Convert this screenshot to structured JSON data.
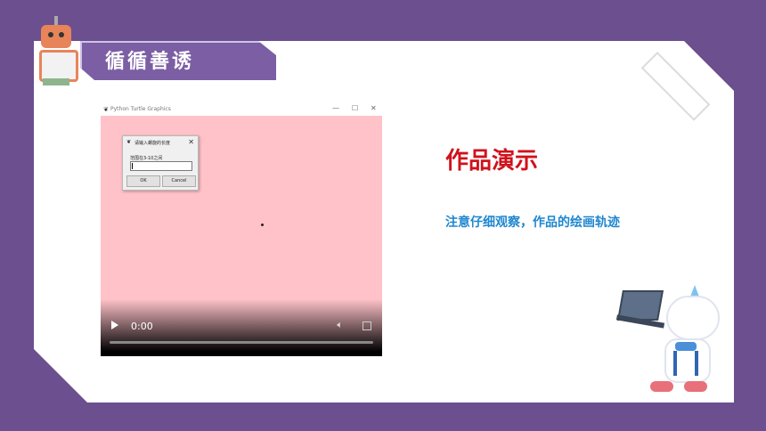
{
  "banner": {
    "title": "循循善诱"
  },
  "video_window": {
    "app_title": "Python Turtle Graphics",
    "minimize": "—",
    "maximize": "☐",
    "close": "✕",
    "dialog": {
      "title": "请输入螺旋的长度",
      "prompt": "范围在3-10之间",
      "input_value": "",
      "ok_label": "OK",
      "cancel_label": "Cancel",
      "close": "✕"
    },
    "player": {
      "time": "0:00",
      "progress": 0
    }
  },
  "main": {
    "heading": "作品演示",
    "subtitle": "注意仔细观察，作品的绘画轨迹"
  },
  "colors": {
    "background": "#6b4f8f",
    "heading": "#d0121b",
    "subtitle": "#1f86cf",
    "canvas": "#ffc2c9"
  }
}
